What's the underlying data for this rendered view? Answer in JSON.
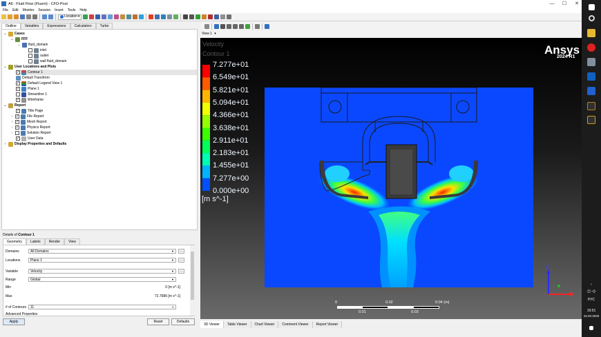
{
  "window": {
    "title": "A6 : Fluid Flow (Fluent) - CFD-Post",
    "minimize": "—",
    "maximize": "☐",
    "close": "✕"
  },
  "menu": [
    "File",
    "Edit",
    "Monitor",
    "Session",
    "Insert",
    "Tools",
    "Help"
  ],
  "toolbar": {
    "location_label": "Location",
    "location_icon": "location-icon"
  },
  "left_tabs": [
    "Outline",
    "Variables",
    "Expressions",
    "Calculators",
    "Turbo"
  ],
  "tree": {
    "cases": "Cases",
    "fff": "FFF",
    "fluid_domain": "fluid_domain",
    "inlet": "inlet",
    "outlet": "outlet",
    "wall": "wall fluid_domain",
    "user_locations": "User Locations and Plots",
    "contour1": "Contour 1",
    "default_transform": "Default Transform",
    "default_legend": "Default Legend View 1",
    "plane1": "Plane 1",
    "streamline1": "Streamline 1",
    "wireframe": "Wireframe",
    "report": "Report",
    "title_page": "Title Page",
    "file_report": "File Report",
    "mesh_report": "Mesh Report",
    "physics_report": "Physics Report",
    "solution_report": "Solution Report",
    "user_data": "User Data",
    "display_props": "Display Properties and Defaults"
  },
  "details": {
    "title_prefix": "Details of",
    "title_name": "Contour 1",
    "tabs": [
      "Geometry",
      "Labels",
      "Render",
      "View"
    ],
    "domains_label": "Domains",
    "domains_value": "All Domains",
    "locations_label": "Locations",
    "locations_value": "Plane 1",
    "variable_label": "Variable",
    "variable_value": "Velocity",
    "range_label": "Range",
    "range_value": "Global",
    "min_label": "Min",
    "min_value": "0 [m s^-1]",
    "max_label": "Max",
    "max_value": "72.7686 [m s^-1]",
    "contours_label": "# of Contours",
    "contours_value": "11",
    "advanced": "Advanced Properties",
    "apply": "Apply",
    "reset": "Reset",
    "defaults": "Defaults"
  },
  "viewer": {
    "view_label": "View 1",
    "legend_title": "Velocity",
    "legend_subtitle": "Contour 1",
    "legend_values": [
      "7.277e+01",
      "6.549e+01",
      "5.821e+01",
      "5.094e+01",
      "4.366e+01",
      "3.638e+01",
      "2.911e+01",
      "2.183e+01",
      "1.455e+01",
      "7.277e+00",
      "0.000e+00"
    ],
    "legend_unit": "[m s^-1]",
    "brand": "Ansys",
    "version": "2024 R1",
    "scale_top": [
      "0",
      "0.02",
      "0.04 (m)"
    ],
    "scale_bottom": [
      "0.01",
      "0.03"
    ],
    "axis_x": "X",
    "axis_z": "Z",
    "bottom_tabs": [
      "3D Viewer",
      "Table Viewer",
      "Chart Viewer",
      "Comment Viewer",
      "Report Viewer"
    ]
  },
  "taskbar": {
    "lang": "РУС",
    "time": "19:51",
    "date": "15.03.2025"
  }
}
